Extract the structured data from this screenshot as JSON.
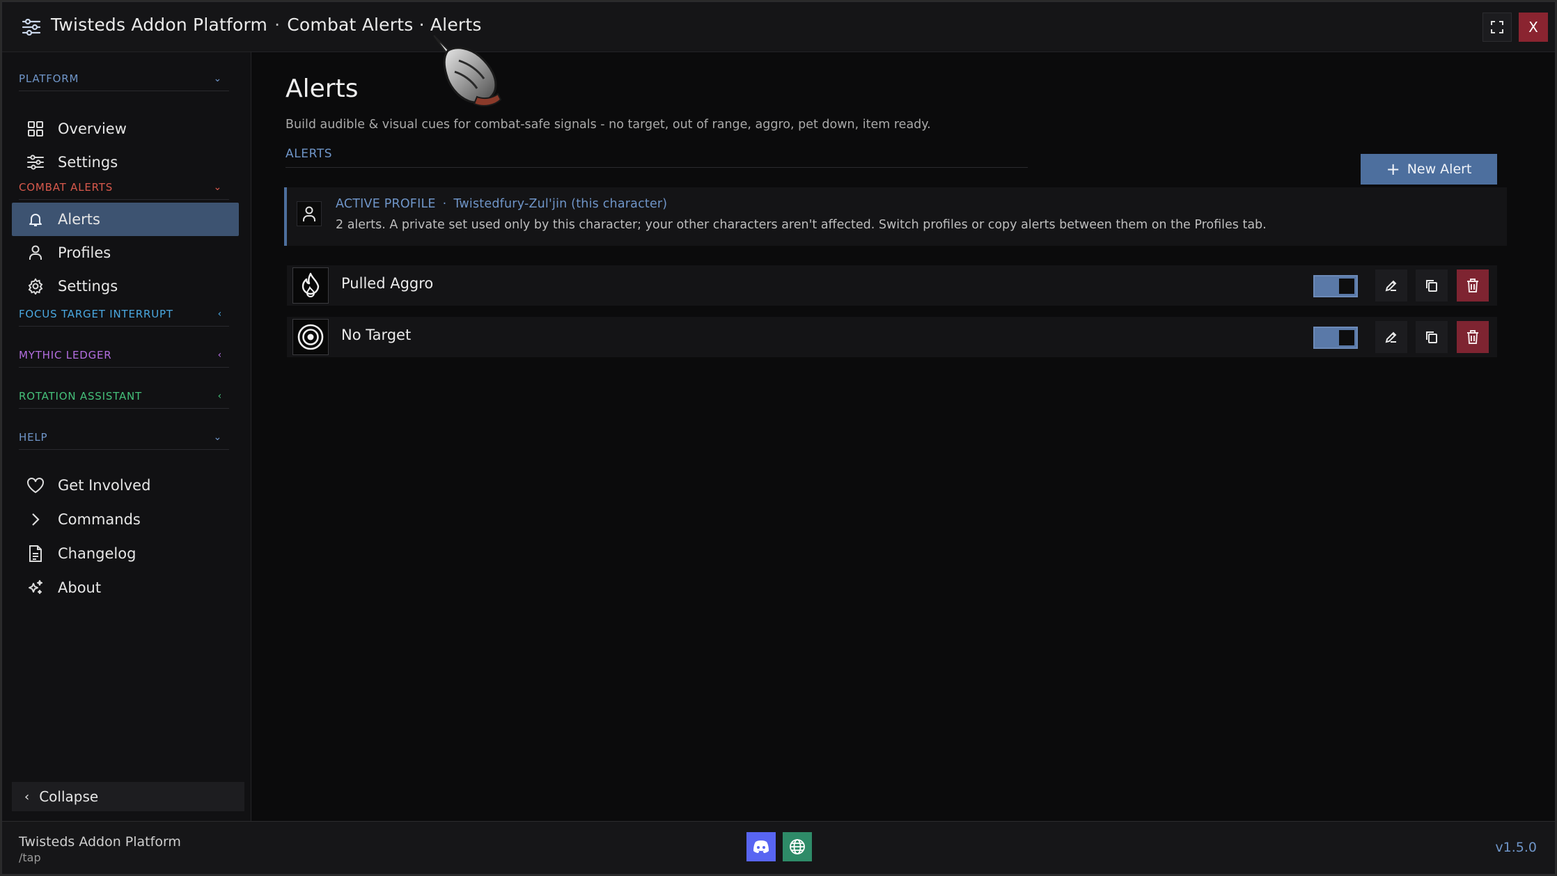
{
  "window": {
    "title_app": "Twisteds Addon Platform",
    "title_separator": "·",
    "title_path": "Combat Alerts · Alerts",
    "close_label": "X"
  },
  "sidebar": {
    "sections": {
      "platform": {
        "label": "PLATFORM",
        "color": "#6f95c8",
        "expanded": true
      },
      "combat_alerts": {
        "label": "COMBAT ALERTS",
        "color": "#d8594c",
        "expanded": true
      },
      "focus_target": {
        "label": "FOCUS TARGET INTERRUPT",
        "color": "#4aa8e0",
        "expanded": false
      },
      "mythic_ledger": {
        "label": "MYTHIC LEDGER",
        "color": "#b36ee0",
        "expanded": false
      },
      "rotation": {
        "label": "ROTATION ASSISTANT",
        "color": "#45c07a",
        "expanded": false
      },
      "help": {
        "label": "HELP",
        "color": "#6f95c8",
        "expanded": true
      }
    },
    "items": {
      "overview": {
        "label": "Overview",
        "icon": "grid-icon"
      },
      "platform_settings": {
        "label": "Settings",
        "icon": "sliders-icon"
      },
      "alerts": {
        "label": "Alerts",
        "icon": "bell-icon",
        "active": true
      },
      "profiles": {
        "label": "Profiles",
        "icon": "user-icon"
      },
      "combat_settings": {
        "label": "Settings",
        "icon": "gear-icon"
      },
      "get_involved": {
        "label": "Get Involved",
        "icon": "heart-icon"
      },
      "commands": {
        "label": "Commands",
        "icon": "chevron-right-icon"
      },
      "changelog": {
        "label": "Changelog",
        "icon": "document-icon"
      },
      "about": {
        "label": "About",
        "icon": "sparkles-icon"
      }
    },
    "collapse_label": "Collapse"
  },
  "main": {
    "title": "Alerts",
    "subtitle": "Build audible & visual cues for combat-safe signals - no target, out of range, aggro, pet down, item ready.",
    "section_label": "ALERTS",
    "new_button_label": "New Alert",
    "profile": {
      "label": "ACTIVE PROFILE",
      "separator": "·",
      "name": "Twistedfury-Zul'jin (this character)",
      "description": "2 alerts.  A private set used only by this character; your other characters aren't affected.  Switch profiles or copy alerts between them on the Profiles tab."
    },
    "alerts": [
      {
        "name": "Pulled Aggro",
        "icon": "flame-icon",
        "enabled": true
      },
      {
        "name": "No Target",
        "icon": "target-icon",
        "enabled": true
      }
    ]
  },
  "footer": {
    "app_name": "Twisteds Addon Platform",
    "command": "/tap",
    "version": "v1.5.0"
  },
  "colors": {
    "accent": "#4d6f9e",
    "danger": "#7e2431",
    "discord": "#5865f2",
    "web": "#2e8b68"
  }
}
